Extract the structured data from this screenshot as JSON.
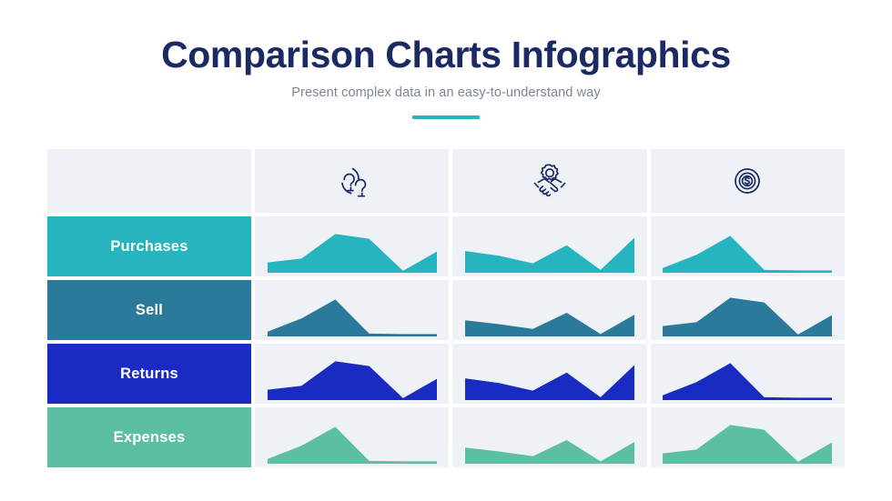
{
  "header": {
    "title": "Comparison Charts Infographics",
    "subtitle": "Present complex data in an easy-to-understand way",
    "accent_color": "#2bb3bd",
    "title_color": "#1b2a63",
    "subtitle_color": "#7b8594"
  },
  "matrix": {
    "cell_background": "#eef1f6",
    "columns": [
      {
        "icon": "people-icon",
        "label": ""
      },
      {
        "icon": "handshake-gear-icon",
        "label": ""
      },
      {
        "icon": "dollar-coin-icon",
        "label": ""
      }
    ],
    "rows": [
      {
        "label": "Purchases",
        "color": "#26b5bf"
      },
      {
        "label": "Sell",
        "color": "#2b7a9b"
      },
      {
        "label": "Returns",
        "color": "#1a2bc4"
      },
      {
        "label": "Expenses",
        "color": "#5cbfa3"
      }
    ]
  },
  "chart_data": {
    "type": "area",
    "title": "Comparison Charts Infographics",
    "subtitle": "Present complex data in an easy-to-understand way",
    "grid": true,
    "legend_position": "none",
    "xlabel": "",
    "ylabel": "",
    "ylim": [
      0,
      100
    ],
    "x": [
      0,
      1,
      2,
      3,
      4,
      5
    ],
    "row_categories": [
      "Purchases",
      "Sell",
      "Returns",
      "Expenses"
    ],
    "column_categories": [
      "people-icon",
      "handshake-gear-icon",
      "dollar-coin-icon"
    ],
    "series": [
      {
        "name": "Purchases / people-icon",
        "row": "Purchases",
        "column": "people-icon",
        "shape": "rise-plateau-dip-rise",
        "color": "#26b5bf",
        "values": [
          22,
          30,
          82,
          72,
          4,
          45
        ]
      },
      {
        "name": "Purchases / handshake-gear-icon",
        "row": "Purchases",
        "column": "handshake-gear-icon",
        "shape": "zigzag-w",
        "color": "#26b5bf",
        "values": [
          46,
          36,
          20,
          58,
          6,
          74
        ]
      },
      {
        "name": "Purchases / dollar-coin-icon",
        "row": "Purchases",
        "column": "dollar-coin-icon",
        "shape": "spike-then-flat",
        "color": "#26b5bf",
        "values": [
          10,
          38,
          78,
          6,
          5,
          5
        ]
      },
      {
        "name": "Sell / people-icon",
        "row": "Sell",
        "column": "people-icon",
        "shape": "spike-then-flat",
        "color": "#2b7a9b",
        "values": [
          10,
          38,
          78,
          6,
          5,
          5
        ]
      },
      {
        "name": "Sell / handshake-gear-icon",
        "row": "Sell",
        "column": "handshake-gear-icon",
        "shape": "zigzag-w",
        "color": "#2b7a9b",
        "values": [
          34,
          26,
          16,
          50,
          5,
          46
        ]
      },
      {
        "name": "Sell / dollar-coin-icon",
        "row": "Sell",
        "column": "dollar-coin-icon",
        "shape": "rise-plateau-dip-rise",
        "color": "#2b7a9b",
        "values": [
          22,
          30,
          82,
          72,
          4,
          45
        ]
      },
      {
        "name": "Returns / people-icon",
        "row": "Returns",
        "column": "people-icon",
        "shape": "rise-plateau-dip-rise",
        "color": "#1a2bc4",
        "values": [
          22,
          30,
          82,
          72,
          4,
          45
        ]
      },
      {
        "name": "Returns / handshake-gear-icon",
        "row": "Returns",
        "column": "handshake-gear-icon",
        "shape": "zigzag-w",
        "color": "#1a2bc4",
        "values": [
          46,
          36,
          20,
          58,
          6,
          74
        ]
      },
      {
        "name": "Returns / dollar-coin-icon",
        "row": "Returns",
        "column": "dollar-coin-icon",
        "shape": "spike-then-flat",
        "color": "#1a2bc4",
        "values": [
          10,
          38,
          78,
          6,
          5,
          5
        ]
      },
      {
        "name": "Expenses / people-icon",
        "row": "Expenses",
        "column": "people-icon",
        "shape": "spike-then-flat",
        "color": "#5cbfa3",
        "values": [
          10,
          38,
          78,
          6,
          5,
          5
        ]
      },
      {
        "name": "Expenses / handshake-gear-icon",
        "row": "Expenses",
        "column": "handshake-gear-icon",
        "shape": "zigzag-w",
        "color": "#5cbfa3",
        "values": [
          34,
          26,
          16,
          50,
          5,
          46
        ]
      },
      {
        "name": "Expenses / dollar-coin-icon",
        "row": "Expenses",
        "column": "dollar-coin-icon",
        "shape": "rise-plateau-dip-rise",
        "color": "#5cbfa3",
        "values": [
          22,
          30,
          82,
          72,
          4,
          45
        ]
      }
    ]
  }
}
